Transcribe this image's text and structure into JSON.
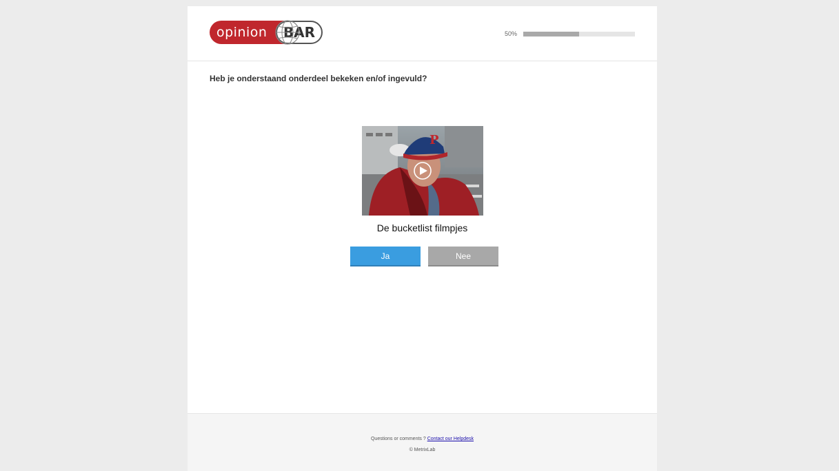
{
  "header": {
    "logo": {
      "left_text": "opinion",
      "right_text": "BAR"
    },
    "progress": {
      "label": "50%",
      "value": 0.5
    }
  },
  "question": {
    "text": "Heb je onderstaand onderdeel bekeken en/of ingevuld?"
  },
  "media": {
    "caption": "De bucketlist filmpjes",
    "icon": "play-icon"
  },
  "answers": {
    "yes_label": "Ja",
    "no_label": "Nee",
    "yes_color": "#3a9de0",
    "no_color": "#a8a8a8"
  },
  "footer": {
    "question_text": "Questions or comments ? ",
    "helpdesk_link": "Contact our Helpdesk",
    "copyright": "© MetrixLab"
  },
  "colors": {
    "brand_red": "#c0272d",
    "background": "#ececec"
  }
}
